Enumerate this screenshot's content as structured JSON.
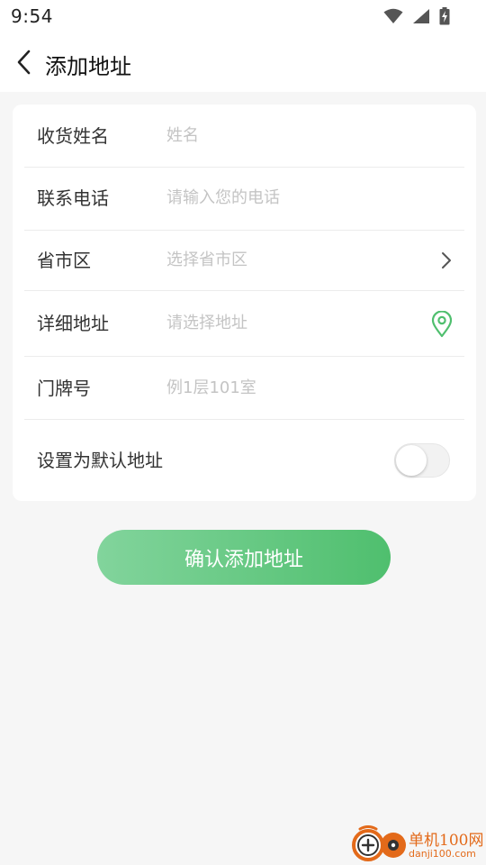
{
  "status_bar": {
    "time": "9:54",
    "icons": [
      "wifi-icon",
      "signal-icon",
      "battery-charging-icon"
    ]
  },
  "app_bar": {
    "back_icon": "chevron-left-icon",
    "title": "添加地址"
  },
  "form": {
    "name": {
      "label": "收货姓名",
      "placeholder": "姓名",
      "value": ""
    },
    "phone": {
      "label": "联系电话",
      "placeholder": "请输入您的电话",
      "value": ""
    },
    "region": {
      "label": "省市区",
      "placeholder": "选择省市区",
      "value": "",
      "trailing_icon": "chevron-right-icon"
    },
    "address": {
      "label": "详细地址",
      "placeholder": "请选择地址",
      "value": "",
      "trailing_icon": "location-pin-icon"
    },
    "door": {
      "label": "门牌号",
      "placeholder": "例1层101室",
      "value": ""
    },
    "default": {
      "label": "设置为默认地址",
      "enabled": false
    }
  },
  "confirm_button": {
    "label": "确认添加地址"
  },
  "watermark": {
    "name_cn": "单机100网",
    "domain": "danji100.com",
    "logo_icon": "danji100-logo-icon"
  },
  "colors": {
    "accent_green": "#4fbf6e",
    "accent_green_light": "#82d49c",
    "background": "#f6f6f6",
    "card": "#ffffff",
    "placeholder": "#c4c4c4",
    "watermark_orange": "#e36a1a"
  }
}
